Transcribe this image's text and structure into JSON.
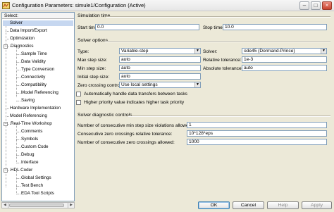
{
  "window": {
    "title": "Configuration Parameters: simule1/Configuration (Active)"
  },
  "tree": {
    "select_label": "Select:",
    "items": [
      {
        "label": "Solver",
        "selected": true
      },
      {
        "label": "Data Import/Export"
      },
      {
        "label": "Optimization"
      },
      {
        "label": "Diagnostics",
        "expander": "−"
      },
      {
        "label": "Sample Time"
      },
      {
        "label": "Data Validity"
      },
      {
        "label": "Type Conversion"
      },
      {
        "label": "Connectivity"
      },
      {
        "label": "Compatibility"
      },
      {
        "label": "Model Referencing"
      },
      {
        "label": "Saving"
      },
      {
        "label": "Hardware Implementation"
      },
      {
        "label": "Model Referencing"
      },
      {
        "label": "Real-Time Workshop",
        "expander": "−"
      },
      {
        "label": "Comments"
      },
      {
        "label": "Symbols"
      },
      {
        "label": "Custom Code"
      },
      {
        "label": "Debug"
      },
      {
        "label": "Interface"
      },
      {
        "label": "HDL Coder",
        "expander": "−"
      },
      {
        "label": "Global Settings"
      },
      {
        "label": "Test Bench"
      },
      {
        "label": "EDA Tool Scripts"
      }
    ]
  },
  "simulation_time": {
    "section_label": "Simulation time",
    "start_label": "Start time:",
    "start_value": "0.0",
    "stop_label": "Stop time:",
    "stop_value": "10.0"
  },
  "solver_options": {
    "section_label": "Solver options",
    "type_label": "Type:",
    "type_value": "Variable-step",
    "solver_label": "Solver:",
    "solver_value": "ode45 (Dormand-Prince)",
    "max_step_label": "Max step size:",
    "max_step_value": "auto",
    "rel_tol_label": "Relative tolerance:",
    "rel_tol_value": "1e-3",
    "min_step_label": "Min step size:",
    "min_step_value": "auto",
    "abs_tol_label": "Absolute tolerance:",
    "abs_tol_value": "auto",
    "initial_step_label": "Initial step size:",
    "initial_step_value": "auto",
    "zero_crossing_label": "Zero crossing control:",
    "zero_crossing_value": "Use local settings",
    "auto_tasks_label": "Automatically handle data transfers between tasks",
    "higher_priority_label": "Higher priority value indicates higher task priority"
  },
  "diagnostic_controls": {
    "section_label": "Solver diagnostic controls",
    "min_step_violations_label": "Number of consecutive min step size violations allowed:",
    "min_step_violations_value": "1",
    "zc_rel_tol_label": "Consecutive zero crossings relative tolerance:",
    "zc_rel_tol_value": "10*128*eps",
    "zc_allowed_label": "Number of consecutive zero crossings allowed:",
    "zc_allowed_value": "1000"
  },
  "buttons": {
    "ok": "OK",
    "cancel": "Cancel",
    "help": "Help",
    "apply": "Apply"
  },
  "window_controls": {
    "minimize": "–",
    "maximize": "□",
    "close": "×",
    "dropdown_arrow": "▼",
    "scroll_left": "◀",
    "scroll_right": "▶"
  }
}
